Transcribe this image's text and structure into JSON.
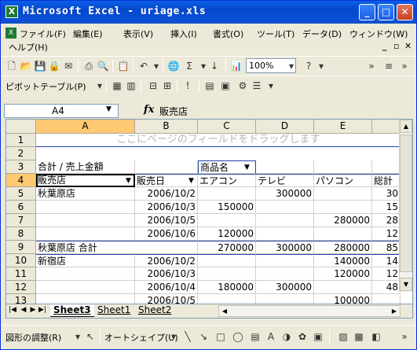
{
  "window": {
    "app_icon": "X",
    "title": "Microsoft Excel - uriage.xls"
  },
  "menubar": {
    "items": [
      "ファイル(F)",
      "編集(E)",
      "表示(V)",
      "挿入(I)",
      "書式(O)",
      "ツール(T)",
      "データ(D)",
      "ウィンドウ(W)",
      "ヘルプ(H)"
    ]
  },
  "toolbar": {
    "zoom": "100%",
    "pivot_label": "ピボットテーブル(P)"
  },
  "formula_bar": {
    "name_box": "A4",
    "fx_label": "fx",
    "content": "販売店"
  },
  "sheet": {
    "columns": [
      "A",
      "B",
      "C",
      "D",
      "E"
    ],
    "rows": [
      "1",
      "2",
      "3",
      "4",
      "5",
      "6",
      "7",
      "8",
      "9",
      "10",
      "11",
      "12",
      "13"
    ],
    "overlay_hint": "ここにページのフィールドをドラッグします",
    "cells": {
      "A3": "合計 / 売上金額",
      "C3": "商品名",
      "A4": "販売店",
      "B4": "販売日",
      "C4": "エアコン",
      "D4": "テレビ",
      "E4": "パソコン",
      "F4": "総計",
      "A5": "秋葉原店",
      "B5": "2006/10/2",
      "D5": "300000",
      "F5": "30",
      "B6": "2006/10/3",
      "C6": "150000",
      "F6": "15",
      "B7": "2006/10/5",
      "E7": "280000",
      "F7": "28",
      "B8": "2006/10/6",
      "C8": "120000",
      "F8": "12",
      "A9": "秋葉原店 合計",
      "C9": "270000",
      "D9": "300000",
      "E9": "280000",
      "F9": "85",
      "A10": "新宿店",
      "B10": "2006/10/2",
      "E10": "140000",
      "F10": "14",
      "B11": "2006/10/3",
      "E11": "120000",
      "F11": "12",
      "B12": "2006/10/4",
      "C12": "180000",
      "D12": "300000",
      "F12": "48",
      "B13": "2006/10/5",
      "E13": "100000"
    }
  },
  "tabs": [
    "Sheet3",
    "Sheet1",
    "Sheet2"
  ],
  "drawbar": {
    "adjust_label": "図形の調整(R)",
    "autoshape_label": "オートシェイプ(U)"
  }
}
